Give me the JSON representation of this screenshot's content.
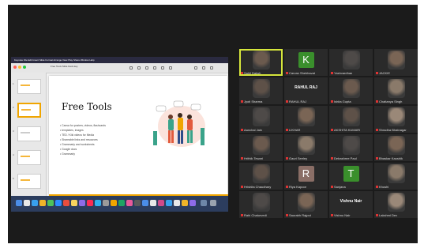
{
  "shared_screen": {
    "menu_text": "Keynote File Edit Insert Slide Format Arrange View Play Share Window Help",
    "document_title": "Free Tools Slide Deck.key",
    "slide": {
      "title": "Free Tools",
      "bullets": [
        "Canva for posters, videos, flashcards",
        "templates, images",
        "TED / Kiki videos for Media",
        "Shareable links and resources",
        "Grammarly and worksheets",
        "Google docs",
        "Grammarly"
      ]
    }
  },
  "participants": [
    {
      "name": "Sahil Daksh",
      "type": "camera"
    },
    {
      "name": "Carvan Shekhavat",
      "type": "letter",
      "letter": "K",
      "color": "#3a8f2c"
    },
    {
      "name": "Yashvardhan",
      "type": "camera"
    },
    {
      "name": "JACKIE",
      "type": "camera"
    },
    {
      "name": "Jyoti Sharma",
      "type": "camera"
    },
    {
      "name": "RAHUL RAJ",
      "type": "name",
      "caption": "RAHUL RAJ"
    },
    {
      "name": "Ishita Gupta",
      "type": "camera"
    },
    {
      "name": "Chaitanya Singh",
      "type": "camera"
    },
    {
      "name": "Aanchal Jain",
      "type": "camera"
    },
    {
      "name": "LIKHAR",
      "type": "camera"
    },
    {
      "name": "AKSHITA KUMARI",
      "type": "camera"
    },
    {
      "name": "Shradha Bhatnagar",
      "type": "camera"
    },
    {
      "name": "Hrithik Tewari",
      "type": "camera"
    },
    {
      "name": "Gauri Seeley",
      "type": "camera"
    },
    {
      "name": "Debashree Paul",
      "type": "camera"
    },
    {
      "name": "Bhaskar Kaushik",
      "type": "camera"
    },
    {
      "name": "Hrishita Chaudhary",
      "type": "camera"
    },
    {
      "name": "Riya Kapoor",
      "type": "letter",
      "letter": "R",
      "color": "#8a6e66"
    },
    {
      "name": "Sanjana",
      "type": "letter",
      "letter": "T",
      "color": "#3a8f2c"
    },
    {
      "name": "Khushi",
      "type": "camera"
    },
    {
      "name": "Rahi Chaturvedi",
      "type": "camera"
    },
    {
      "name": "Saurabh Rajput",
      "type": "camera"
    },
    {
      "name": "Vishnu Nair",
      "type": "name",
      "caption": "Vishnu Nair"
    },
    {
      "name": "Lakshmi Dev",
      "type": "camera"
    }
  ]
}
